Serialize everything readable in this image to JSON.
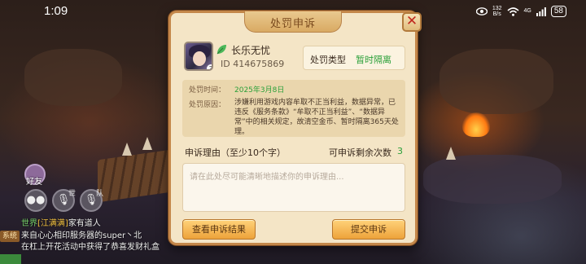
{
  "status_bar": {
    "time": "1:09",
    "icons": [
      "eye-icon",
      "network-speed",
      "wifi-icon",
      "signal-icon",
      "battery-icon"
    ],
    "speed_value": "132",
    "speed_unit": "B/s",
    "signal_label": "4G",
    "battery": "58"
  },
  "hud": {
    "friends_label": "好友",
    "world_tag": "世",
    "team_tag": "队",
    "system_badge": "系统",
    "chat": [
      {
        "channel": "世界",
        "name": "[江满满]",
        "text": "家有道人"
      },
      {
        "channel": "",
        "name": "",
        "text": "来自心心相印服务器的super丶北"
      },
      {
        "channel": "",
        "name": "",
        "text": "在杠上开花活动中获得了恭喜发财礼盒"
      }
    ]
  },
  "dialog": {
    "title": "处罚申诉",
    "player": {
      "name": "长乐无忧",
      "id_text": "ID 414675869",
      "level_badge": "2"
    },
    "punishment": {
      "type_label": "处罚类型",
      "type_value": "暂时隔离"
    },
    "info": {
      "time_label": "处罚时间：",
      "time_value": "2025年3月8日",
      "reason_label": "处罚原因：",
      "reason_value": "涉嫌利用游戏内容牟取不正当利益，数据异常，已违反《服务条款》“牟取不正当利益”、“数据异常”中的相关规定，故清空金币、暂时隔离365天处理。"
    },
    "appeal": {
      "label": "申诉理由（至少10个字）",
      "remaining_label": "可申诉剩余次数",
      "remaining_value": "3",
      "placeholder": "请在此处尽可能清晰地描述你的申诉理由..."
    },
    "buttons": {
      "view_result": "查看申诉结果",
      "submit": "提交申诉"
    }
  },
  "colors": {
    "accent_green": "#2ba03a",
    "panel_bg": "#f4e5c6",
    "button_orange": "#eda33a",
    "close_red": "#c0281e"
  }
}
